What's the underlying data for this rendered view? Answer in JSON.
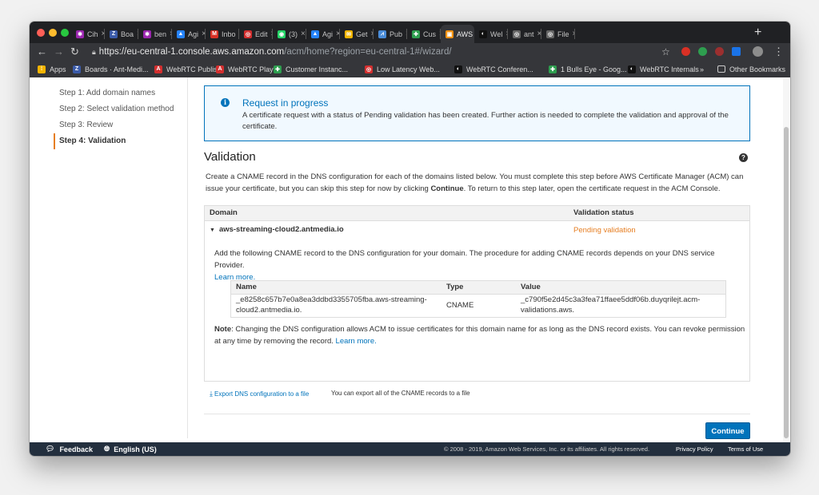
{
  "browser": {
    "tabs": [
      {
        "label": "Cih",
        "favicon_color": "#9c27b0",
        "glyph": "✱"
      },
      {
        "label": "Boa",
        "favicon_color": "#3b5ba9",
        "glyph": "Z"
      },
      {
        "label": "ben",
        "favicon_color": "#9c27b0",
        "glyph": "✱"
      },
      {
        "label": "Agi",
        "favicon_color": "#2684ff",
        "glyph": "▲"
      },
      {
        "label": "Inbo",
        "favicon_color": "#d93025",
        "glyph": "M"
      },
      {
        "label": "Edit",
        "favicon_color": "#d32f2f",
        "glyph": "◎"
      },
      {
        "label": "(3)",
        "favicon_color": "#25d366",
        "glyph": "◉"
      },
      {
        "label": "Agi",
        "favicon_color": "#2684ff",
        "glyph": "▲"
      },
      {
        "label": "Get",
        "favicon_color": "#f4b400",
        "glyph": "✉"
      },
      {
        "label": "Pub",
        "favicon_color": "#4a8cd8",
        "glyph": "⩘"
      },
      {
        "label": "Cus",
        "favicon_color": "#2e9e4f",
        "glyph": "✚"
      },
      {
        "label": "AWS",
        "favicon_color": "#f29111",
        "glyph": "▣",
        "active": true
      },
      {
        "label": "Wel",
        "favicon_color": "#111111",
        "glyph": "◐"
      },
      {
        "label": "ant",
        "favicon_color": "#666666",
        "glyph": "◎"
      },
      {
        "label": "File",
        "favicon_color": "#666666",
        "glyph": "◎"
      }
    ],
    "url_host": "https://eu-central-1.console.aws.amazon.com",
    "url_path": "/acm/home?region=eu-central-1#/wizard/",
    "bookmarks": [
      {
        "label": "Apps",
        "favicon_color": "#f4b400",
        "glyph": "⁞"
      },
      {
        "label": "Boards · Ant-Medi...",
        "favicon_color": "#3b5ba9",
        "glyph": "Z"
      },
      {
        "label": "WebRTC Publish",
        "favicon_color": "#d32f2f",
        "glyph": "A"
      },
      {
        "label": "WebRTC Player",
        "favicon_color": "#d32f2f",
        "glyph": "A"
      },
      {
        "label": "Customer Instanc...",
        "favicon_color": "#2e9e4f",
        "glyph": "✚"
      },
      {
        "label": "Low Latency Web...",
        "favicon_color": "#d32f2f",
        "glyph": "◎"
      },
      {
        "label": "WebRTC Conferen...",
        "favicon_color": "#111111",
        "glyph": "◐"
      },
      {
        "label": "1 Bulls Eye - Goog...",
        "favicon_color": "#2e9e4f",
        "glyph": "✚"
      },
      {
        "label": "WebRTC Internals",
        "favicon_color": "#111111",
        "glyph": "◐"
      }
    ],
    "overflow": "»",
    "other_bookmarks": "Other Bookmarks"
  },
  "wizard": {
    "steps": [
      {
        "label": "Step 1: Add domain names"
      },
      {
        "label": "Step 2: Select validation method"
      },
      {
        "label": "Step 3: Review"
      },
      {
        "label": "Step 4: Validation",
        "active": true
      }
    ]
  },
  "alert": {
    "title": "Request in progress",
    "body": "A certificate request with a status of Pending validation has been created. Further action is needed to complete the validation and approval of the certificate."
  },
  "validation": {
    "heading": "Validation",
    "intro_1": "Create a CNAME record in the DNS configuration for each of the domains listed below. You must complete this step before AWS Certificate Manager (ACM) can issue your certificate, but you can skip this step for now by clicking ",
    "intro_bold": "Continue",
    "intro_2": ". To return to this step later, open the certificate request in the ACM Console.",
    "col_domain": "Domain",
    "col_status": "Validation status",
    "domain": "aws-streaming-cloud2.antmedia.io",
    "status": "Pending validation",
    "instructions": "Add the following CNAME record to the DNS configuration for your domain. The procedure for adding CNAME records depends on your DNS service Provider.",
    "learn_more_1": "Learn more.",
    "record": {
      "col_name": "Name",
      "col_type": "Type",
      "col_value": "Value",
      "name": "_e8258c657b7e0a8ea3ddbd3355705fba.aws-streaming-cloud2.antmedia.io.",
      "type": "CNAME",
      "value": "_c790f5e2d45c3a3fea71ffaee5ddf06b.duyqrilejt.acm-validations.aws."
    },
    "note_label": "Note",
    "note_body": ": Changing the DNS configuration allows ACM to issue certificates for this domain name for as long as the DNS record exists. You can revoke permission at any time by removing the record. ",
    "learn_more_2": "Learn more.",
    "export_label": "Export DNS configuration to a file",
    "export_desc": "You can export all of the CNAME records to a file",
    "continue_label": "Continue"
  },
  "footer": {
    "feedback": "Feedback",
    "language": "English (US)",
    "copyright": "© 2008 - 2019, Amazon Web Services, Inc. or its affiliates. All rights reserved.",
    "privacy": "Privacy Policy",
    "terms": "Terms of Use"
  },
  "colors": {
    "accent": "#0073bb",
    "pending": "#e67e22",
    "footer_bg": "#232f3e"
  }
}
